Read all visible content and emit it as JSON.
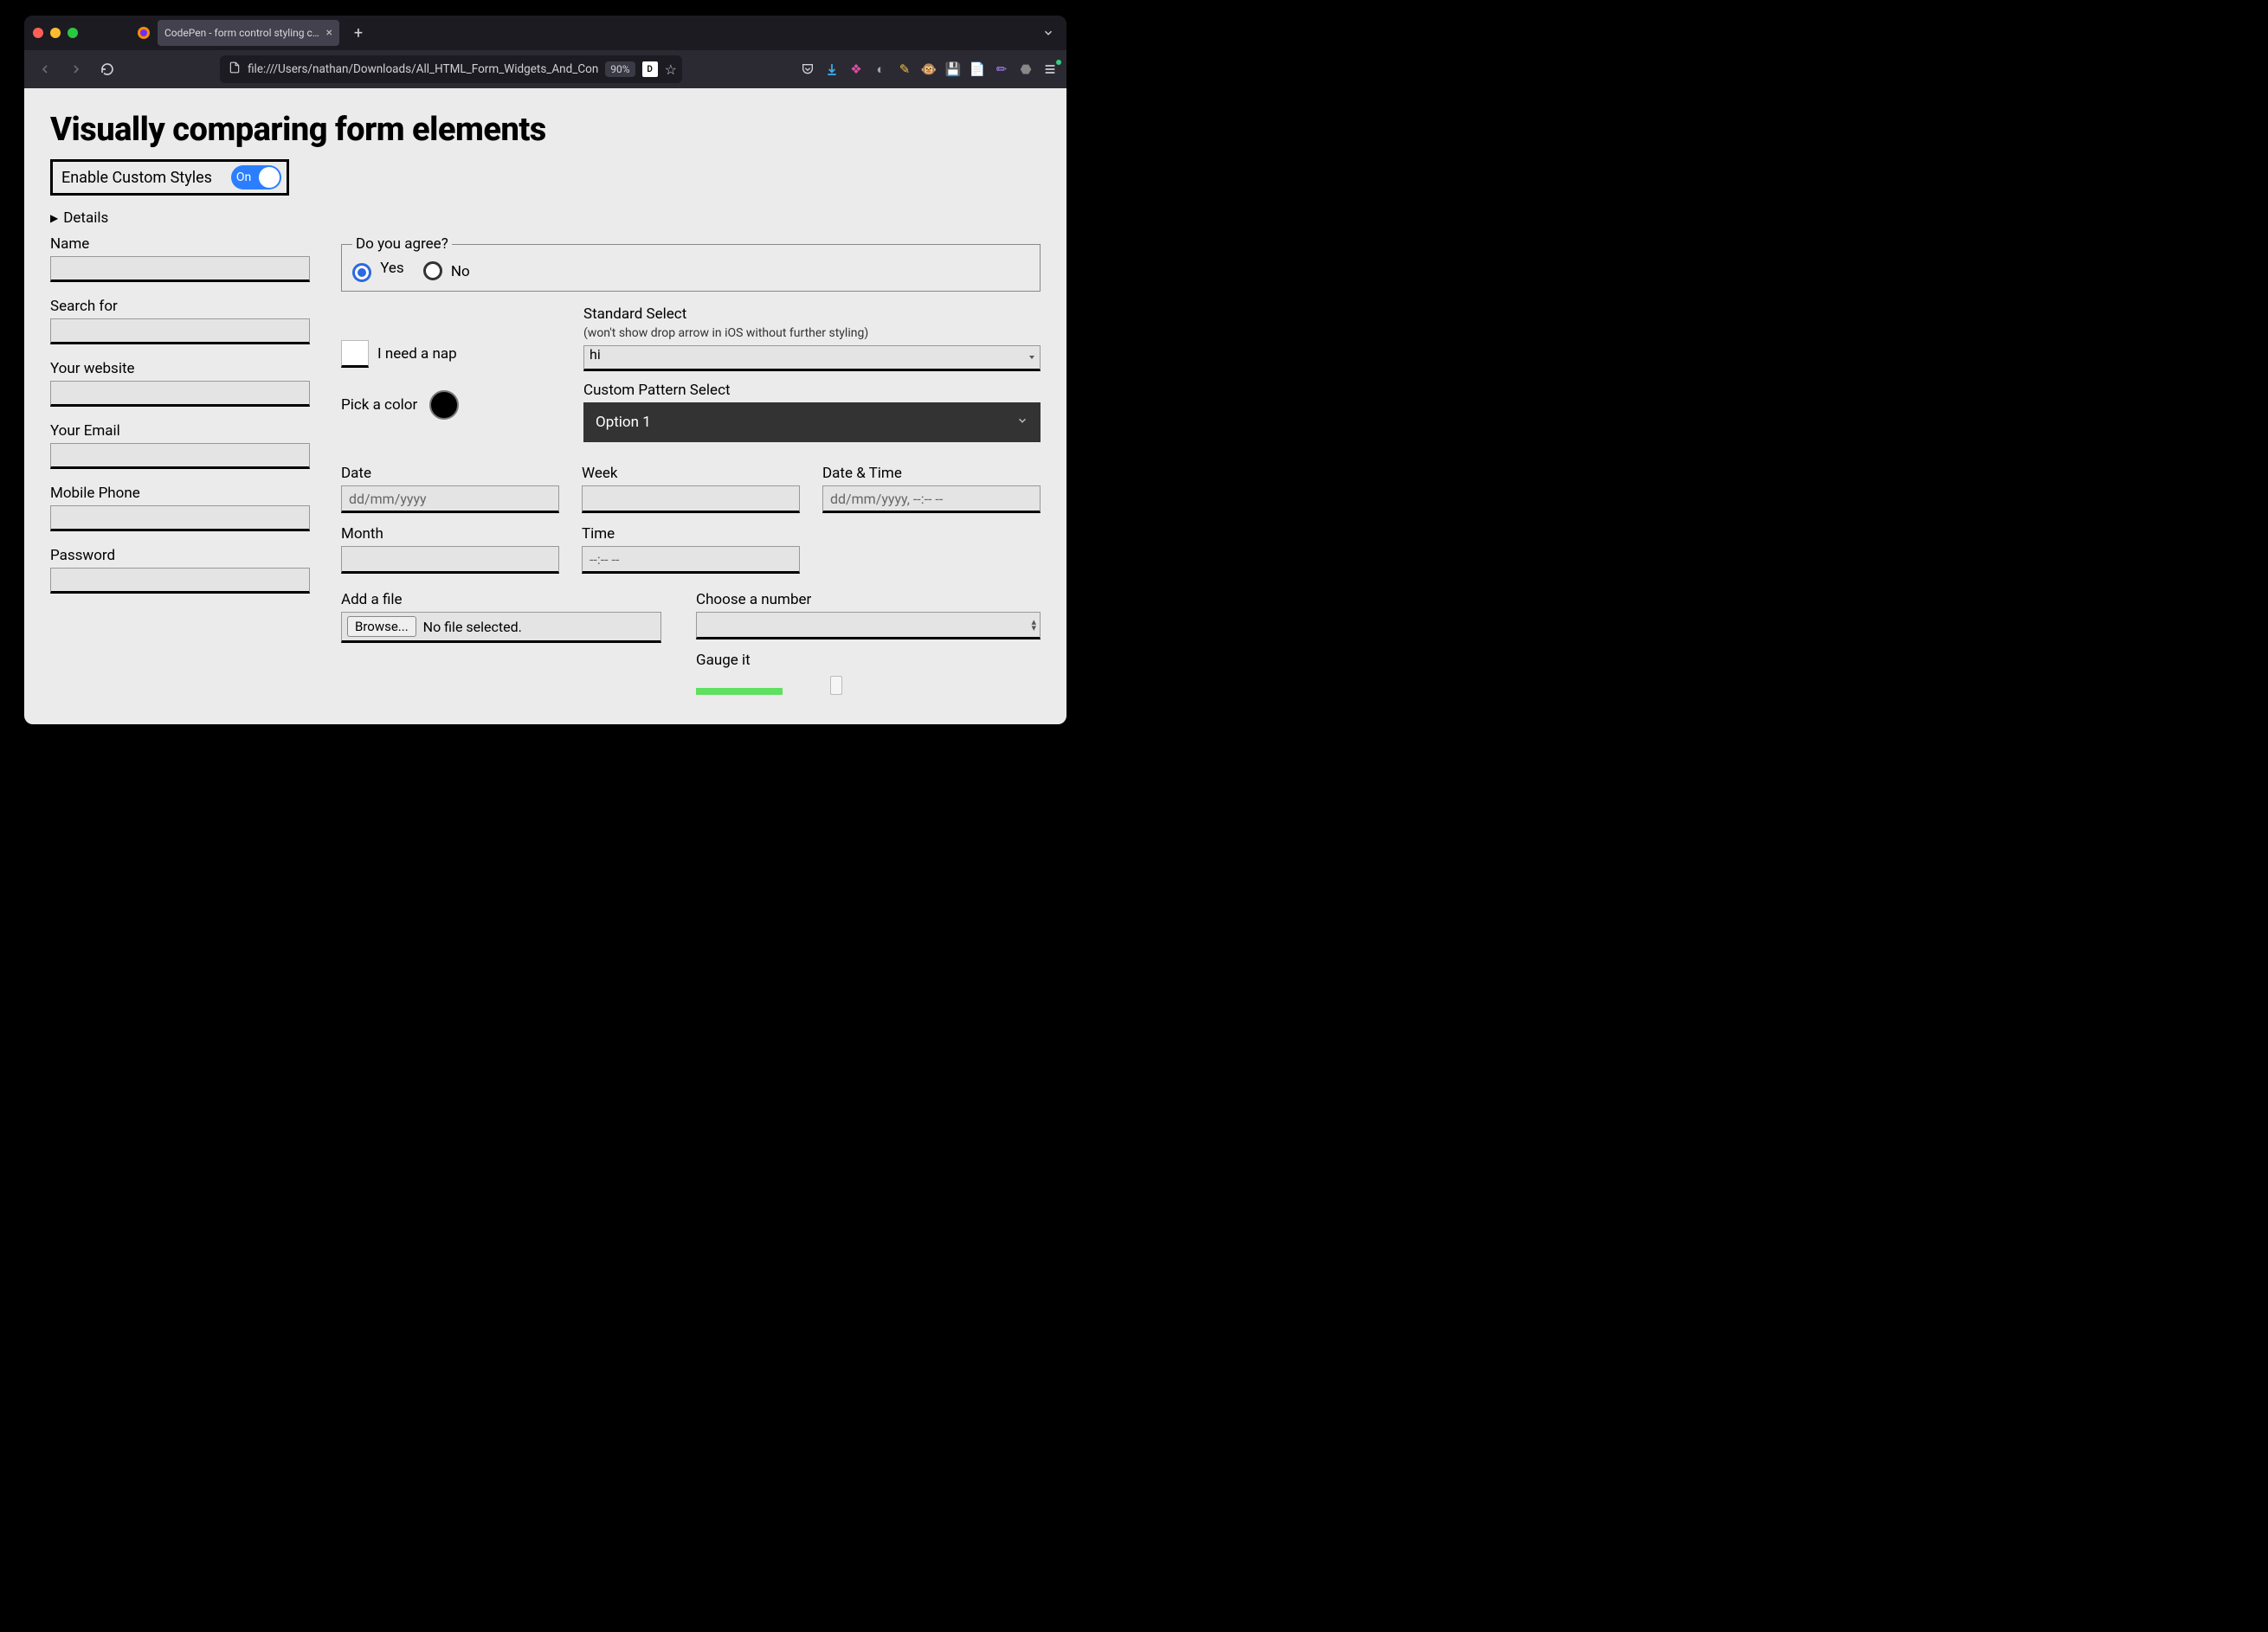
{
  "browser": {
    "tab_title": "CodePen - form control styling comp",
    "url": "file:///Users/nathan/Downloads/All_HTML_Form_Widgets_And_Con",
    "zoom": "90%",
    "reader_badge": "D"
  },
  "page": {
    "title": "Visually comparing form elements",
    "enable_label": "Enable Custom Styles",
    "enable_switch_text": "On",
    "details_label": "Details"
  },
  "left": {
    "name": "Name",
    "search": "Search for",
    "website": "Your website",
    "email": "Your Email",
    "phone": "Mobile Phone",
    "password": "Password"
  },
  "agree": {
    "legend": "Do you agree?",
    "yes": "Yes",
    "no": "No"
  },
  "nap": {
    "label": "I need a nap"
  },
  "color": {
    "label": "Pick a color"
  },
  "std_select": {
    "label": "Standard Select",
    "sub": "(won't show drop arrow in iOS without further styling)",
    "value": "hi"
  },
  "custom_select": {
    "label": "Custom Pattern Select",
    "value": "Option 1"
  },
  "dates": {
    "date_label": "Date",
    "date_placeholder": "dd/mm/yyyy",
    "week_label": "Week",
    "datetime_label": "Date & Time",
    "datetime_placeholder": "dd/mm/yyyy, --:-- --",
    "month_label": "Month",
    "time_label": "Time",
    "time_placeholder": "--:-- --"
  },
  "file": {
    "label": "Add a file",
    "browse": "Browse...",
    "status": "No file selected."
  },
  "number": {
    "label": "Choose a number"
  },
  "gauge": {
    "label": "Gauge it"
  }
}
